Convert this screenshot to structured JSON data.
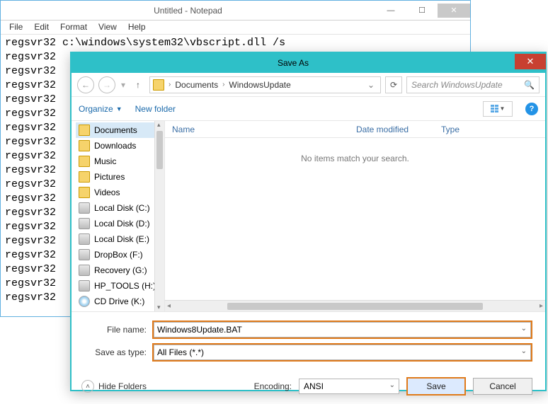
{
  "notepad": {
    "title": "Untitled - Notepad",
    "menu": [
      "File",
      "Edit",
      "Format",
      "View",
      "Help"
    ],
    "firstline": "regsvr32 c:\\windows\\system32\\vbscript.dll /s",
    "repeatline": "regsvr32",
    "repeat_count": 18
  },
  "saveas": {
    "title": "Save As",
    "breadcrumb": {
      "p1": "Documents",
      "p2": "WindowsUpdate"
    },
    "search_placeholder": "Search WindowsUpdate",
    "toolbar": {
      "organize": "Organize",
      "newfolder": "New folder"
    },
    "tree": [
      {
        "label": "Documents",
        "icon": "folder",
        "sel": true
      },
      {
        "label": "Downloads",
        "icon": "folder"
      },
      {
        "label": "Music",
        "icon": "folder"
      },
      {
        "label": "Pictures",
        "icon": "folder"
      },
      {
        "label": "Videos",
        "icon": "folder"
      },
      {
        "label": "Local Disk (C:)",
        "icon": "disk"
      },
      {
        "label": "Local Disk (D:)",
        "icon": "disk"
      },
      {
        "label": "Local Disk (E:)",
        "icon": "disk"
      },
      {
        "label": "DropBox (F:)",
        "icon": "disk"
      },
      {
        "label": "Recovery (G:)",
        "icon": "disk"
      },
      {
        "label": "HP_TOOLS (H:)",
        "icon": "disk"
      },
      {
        "label": "CD Drive (K:)",
        "icon": "cd"
      }
    ],
    "columns": {
      "name": "Name",
      "date": "Date modified",
      "type": "Type"
    },
    "empty_msg": "No items match your search.",
    "fields": {
      "filename_label": "File name:",
      "filename_value": "Windows8Update.BAT",
      "type_label": "Save as type:",
      "type_value": "All Files  (*.*)"
    },
    "bottom": {
      "hide_folders": "Hide Folders",
      "encoding_label": "Encoding:",
      "encoding_value": "ANSI",
      "save": "Save",
      "cancel": "Cancel"
    }
  }
}
